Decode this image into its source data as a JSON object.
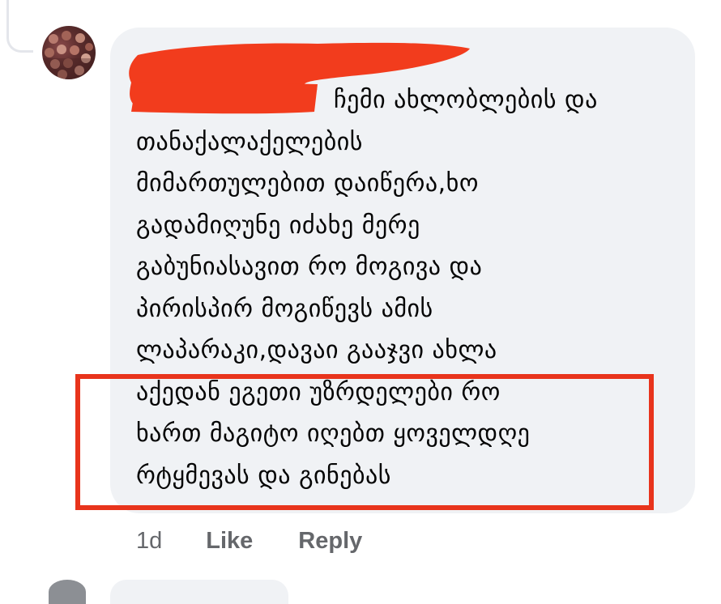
{
  "comment": {
    "lines": [
      "ჩემი ახლობლების და",
      "თანაქალაქელების",
      "მიმართულებით დაიწერა,ხო",
      "გადამიღუნე იძახე მერე",
      "გაბუნიასავით რო მოგივა და",
      "პირისპირ მოგიწევს ამის",
      "ლაპარაკი,დავაი გააჯვი ახლა",
      "აქედან ეგეთი უზრდელები რო",
      "ხართ მაგიტო იღებთ ყოველდღე",
      "რტყმევას და გინებას"
    ]
  },
  "actions": {
    "time": "1d",
    "like": "Like",
    "reply": "Reply"
  },
  "colors": {
    "bubble": "#f0f2f5",
    "redaction": "#f23c1d",
    "highlight_border": "#e8341c",
    "action_text": "#65676b"
  },
  "icons": {
    "avatar": "profile-photo"
  }
}
